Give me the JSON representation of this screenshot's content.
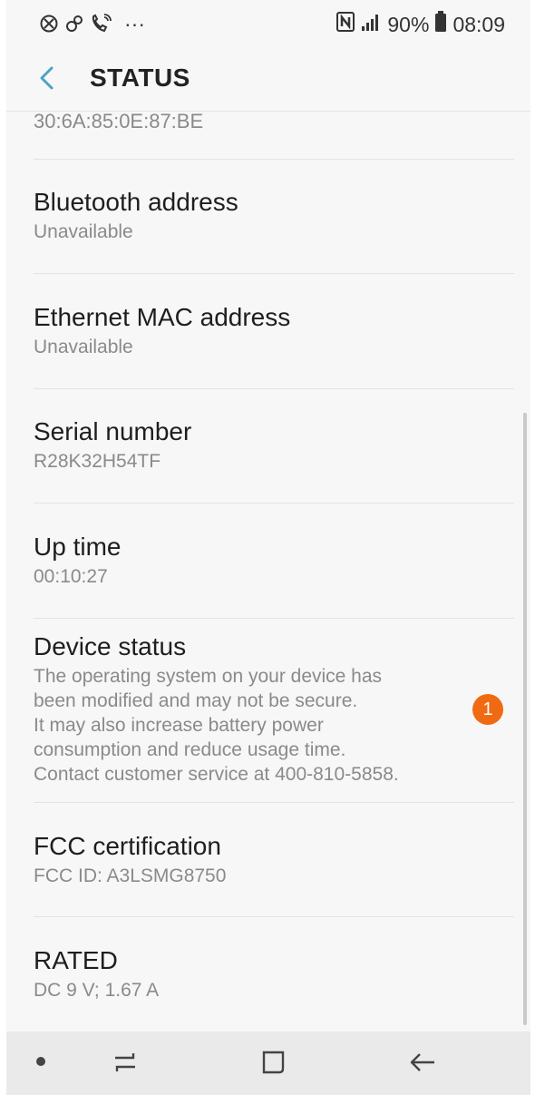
{
  "statusbar": {
    "left_icons": [
      "data-saver-icon",
      "link-icon",
      "wifi-call-icon",
      "more-icon"
    ],
    "more_text": "···",
    "nfc_icon": "nfc-icon",
    "signal_icon": "signal-icon",
    "battery_percent": "90%",
    "battery_icon": "battery-icon",
    "time": "08:09"
  },
  "appbar": {
    "title": "STATUS",
    "back_icon": "back-arrow-icon"
  },
  "list": {
    "top_value": "30:6A:85:0E:87:BE",
    "items": [
      {
        "title": "Bluetooth address",
        "value": "Unavailable"
      },
      {
        "title": "Ethernet MAC address",
        "value": "Unavailable"
      },
      {
        "title": "Serial number",
        "value": "R28K32H54TF"
      },
      {
        "title": "Up time",
        "value": "00:10:27"
      },
      {
        "title": "Device status",
        "lines": [
          "The operating system on your device has",
          "been modified and may not be secure.",
          "It may also increase battery power",
          "consumption and reduce usage time.",
          "Contact customer service at 400-810-5858."
        ],
        "badge": "1"
      },
      {
        "title": "FCC certification",
        "value": "FCC ID: A3LSMG8750"
      },
      {
        "title": "RATED",
        "value": "DC 9 V; 1.67 A"
      }
    ]
  },
  "navbar": {
    "icons": [
      "nav-dot-icon",
      "recent-apps-icon",
      "home-icon",
      "back-icon"
    ]
  },
  "colors": {
    "background": "#f7f7f7",
    "accent": "#4aa3c8",
    "badge": "#f06a13",
    "subtext": "#8a8a8a"
  }
}
